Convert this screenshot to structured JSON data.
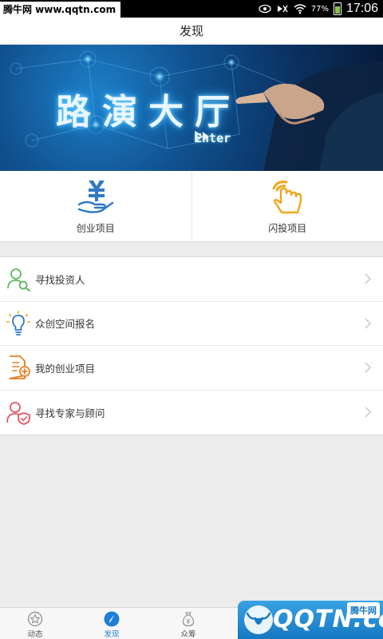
{
  "status_bar": {
    "watermark": "腾牛网 www.qqtn.com",
    "battery_percent": "77%",
    "time": "17:06",
    "icons": [
      "eye-icon",
      "signal-mute-icon",
      "wifi-icon",
      "battery-icon"
    ]
  },
  "header": {
    "title": "发现"
  },
  "banner": {
    "title": "路演大厅",
    "enter": "Enter"
  },
  "quick_entries": [
    {
      "label": "创业项目",
      "icon": "money-hand-icon"
    },
    {
      "label": "闪投项目",
      "icon": "tap-hand-icon"
    }
  ],
  "list": [
    {
      "label": "寻找投资人",
      "icon": "investor-search-icon"
    },
    {
      "label": "众创空间报名",
      "icon": "lightbulb-icon"
    },
    {
      "label": "我的创业项目",
      "icon": "document-add-icon"
    },
    {
      "label": "寻找专家与顾问",
      "icon": "expert-shield-icon"
    }
  ],
  "bottom_nav": {
    "tabs": [
      {
        "label": "动态",
        "icon": "star-icon",
        "active": false
      },
      {
        "label": "发现",
        "icon": "compass-icon",
        "active": true
      },
      {
        "label": "众筹",
        "icon": "money-bag-icon",
        "active": false
      }
    ]
  },
  "watermark_bottom": {
    "brand": "QQTN.com",
    "badge": "腾牛网"
  },
  "colors": {
    "accent_blue": "#1f7fd8",
    "green": "#5cb85c",
    "orange": "#e67e22",
    "pink": "#e2586a",
    "icon_blue": "#2f79c4",
    "quick_orange": "#f1a51a"
  }
}
